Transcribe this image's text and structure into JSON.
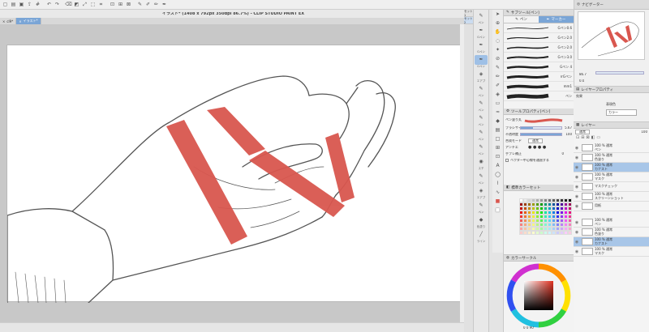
{
  "document": {
    "title": "イラスト* (1408 x 792px 350dpi 86.7%)  - CLIP STUDIO PAINT EX",
    "tabs": [
      {
        "label": "cl9*"
      },
      {
        "label": "イラスト*"
      }
    ]
  },
  "sets": [
    "セット1",
    "セット2"
  ],
  "tools": [
    {
      "label": "ペン",
      "icon": "pen-icon"
    },
    {
      "label": "Gペン",
      "icon": "g-pen-icon"
    },
    {
      "label": "Gペン",
      "icon": "g-pen-icon"
    },
    {
      "label": "Gペン",
      "icon": "g-pen-icon"
    },
    {
      "label": "エアブ",
      "icon": "airbrush-icon"
    },
    {
      "label": "ペン",
      "icon": "pen-icon"
    },
    {
      "label": "ペン",
      "icon": "pen-icon"
    },
    {
      "label": "ペン",
      "icon": "pen-icon"
    },
    {
      "label": "ペン",
      "icon": "pen-icon"
    },
    {
      "label": "ペン",
      "icon": "pen-icon"
    },
    {
      "label": "スチ",
      "icon": "stamp-icon"
    },
    {
      "label": "ペン",
      "icon": "pen-icon"
    },
    {
      "label": "エアブ",
      "icon": "airbrush-icon"
    },
    {
      "label": "ペン",
      "icon": "pen-icon"
    },
    {
      "label": "色塗り",
      "icon": "fill-icon"
    },
    {
      "label": "ライン",
      "icon": "line-icon"
    }
  ],
  "subtool": {
    "title": "サブツール[ペン]",
    "tabs": [
      "ペン",
      "マーカー"
    ],
    "brushes": [
      "Gペン0.6",
      "Gペン2.0",
      "Gペン2.0",
      "Gペン3.0",
      "Gペン 4",
      "rrGペン",
      "mm1",
      "ペン"
    ]
  },
  "tool_property": {
    "title": "ツールプロパティ[ペン]",
    "brush_name": "ペン塗り丸",
    "rows": [
      {
        "label": "ブラシサイズ",
        "value": "5.67"
      },
      {
        "label": "不透明度",
        "value": "100"
      },
      {
        "label": "合成モード",
        "value": "通常"
      },
      {
        "label": "アンチエ",
        "value": ""
      },
      {
        "label": "手ブレ補正",
        "value": "0"
      }
    ],
    "checkbox": "ベクター中心線を通過する"
  },
  "color_set": {
    "title": "標準カラーセット"
  },
  "color_circle": {
    "title": "カラーサークル",
    "values": [
      "0",
      "0",
      "90"
    ]
  },
  "navigator": {
    "title": "ナビゲーター",
    "zoom": "86.7",
    "angle": "0.0"
  },
  "layer_property": {
    "title": "レイヤープロパティ",
    "effect_label": "効果",
    "display_label": "表現色",
    "display_value": "カラー"
  },
  "layers": {
    "title": "レイヤー",
    "blend": "通常",
    "opacity": "100",
    "rows": [
      {
        "name": "100 % 通常\nペン",
        "selected": false
      },
      {
        "name": "100 % 通常\n色塗り",
        "selected": false
      },
      {
        "name": "100 % 通常\nカナスト",
        "selected": true
      },
      {
        "name": "100 % 通常\nマスク",
        "selected": false
      },
      {
        "name": "マスクチェック",
        "selected": false
      },
      {
        "name": "100 % 通常\nスクリーンショット",
        "selected": false
      },
      {
        "name": "用紙",
        "selected": false
      }
    ],
    "bottom_rows": [
      {
        "name": "100 % 通常\nペン",
        "selected": false
      },
      {
        "name": "100 % 通常\n色塗り",
        "selected": false
      },
      {
        "name": "100 % 通常\nカナスト",
        "selected": true
      },
      {
        "name": "100 % 通常\nマスク",
        "selected": false
      }
    ]
  },
  "colors": {
    "accent": "#7aa5d6",
    "band": "#d9574f",
    "selected_row": "#a8c6e8"
  }
}
